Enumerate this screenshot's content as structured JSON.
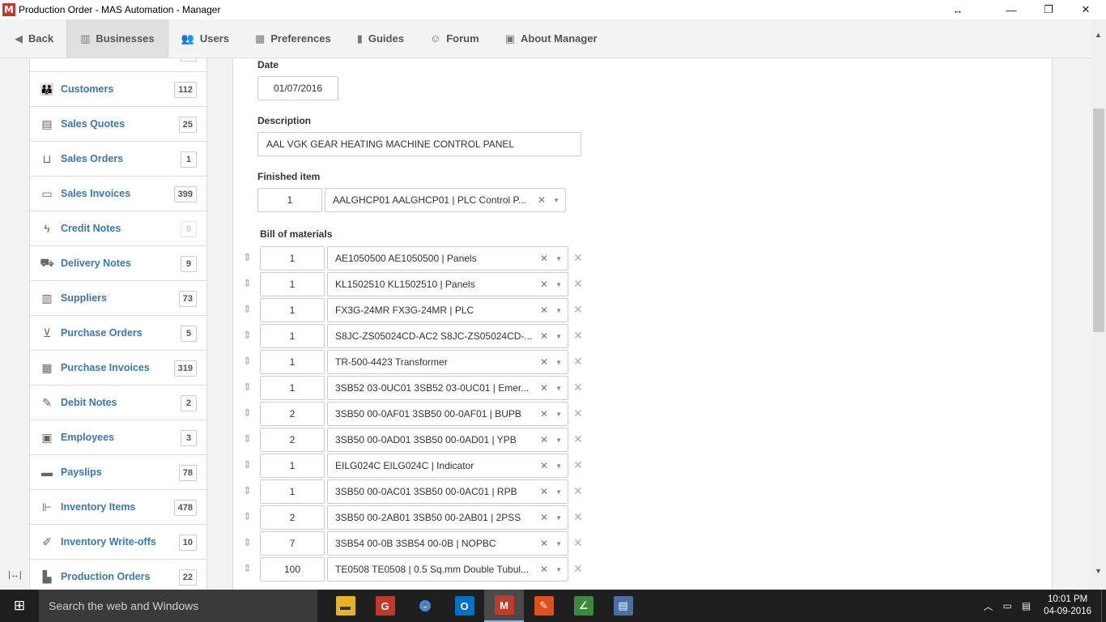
{
  "window": {
    "title": "Production Order - MAS Automation - Manager",
    "app_logo": "M",
    "controls": {
      "move": "↔",
      "minimize": "—",
      "maximize": "❐",
      "close": "✕"
    }
  },
  "nav": {
    "back": "Back",
    "businesses": "Businesses",
    "users": "Users",
    "preferences": "Preferences",
    "guides": "Guides",
    "forum": "Forum",
    "about": "About Manager"
  },
  "sidebar": {
    "items": [
      {
        "label": "Customers",
        "count": "112",
        "icon": "customers-icon"
      },
      {
        "label": "Sales Quotes",
        "count": "25",
        "icon": "sales-quotes-icon"
      },
      {
        "label": "Sales Orders",
        "count": "1",
        "icon": "sales-orders-icon"
      },
      {
        "label": "Sales Invoices",
        "count": "399",
        "icon": "sales-invoices-icon"
      },
      {
        "label": "Credit Notes",
        "count": "0",
        "icon": "credit-notes-icon"
      },
      {
        "label": "Delivery Notes",
        "count": "9",
        "icon": "delivery-notes-icon"
      },
      {
        "label": "Suppliers",
        "count": "73",
        "icon": "suppliers-icon"
      },
      {
        "label": "Purchase Orders",
        "count": "5",
        "icon": "purchase-orders-icon"
      },
      {
        "label": "Purchase Invoices",
        "count": "319",
        "icon": "purchase-invoices-icon"
      },
      {
        "label": "Debit Notes",
        "count": "2",
        "icon": "debit-notes-icon"
      },
      {
        "label": "Employees",
        "count": "3",
        "icon": "employees-icon"
      },
      {
        "label": "Payslips",
        "count": "78",
        "icon": "payslips-icon"
      },
      {
        "label": "Inventory Items",
        "count": "478",
        "icon": "inventory-items-icon"
      },
      {
        "label": "Inventory Write-offs",
        "count": "10",
        "icon": "inventory-writeoffs-icon"
      },
      {
        "label": "Production Orders",
        "count": "22",
        "icon": "production-orders-icon"
      }
    ]
  },
  "form": {
    "date_label": "Date",
    "date_value": "01/07/2016",
    "description_label": "Description",
    "description_value": "AAL VGK GEAR HEATING MACHINE CONTROL PANEL",
    "finished_item_label": "Finished item",
    "finished_qty": "1",
    "finished_item": "AALGHCP01 AALGHCP01 | PLC Control P...",
    "bom_label": "Bill of materials",
    "bom": [
      {
        "qty": "1",
        "item": "AE1050500 AE1050500 | Panels"
      },
      {
        "qty": "1",
        "item": "KL1502510 KL1502510 | Panels"
      },
      {
        "qty": "1",
        "item": "FX3G-24MR FX3G-24MR | PLC"
      },
      {
        "qty": "1",
        "item": "S8JC-ZS05024CD-AC2 S8JC-ZS05024CD-..."
      },
      {
        "qty": "1",
        "item": "TR-500-4423 Transformer"
      },
      {
        "qty": "1",
        "item": "3SB52 03-0UC01 3SB52 03-0UC01 | Emer..."
      },
      {
        "qty": "2",
        "item": "3SB50 00-0AF01 3SB50 00-0AF01 | BUPB"
      },
      {
        "qty": "2",
        "item": "3SB50 00-0AD01 3SB50 00-0AD01 | YPB"
      },
      {
        "qty": "1",
        "item": "EILG024C EILG024C | Indicator"
      },
      {
        "qty": "1",
        "item": "3SB50 00-0AC01 3SB50 00-0AC01 | RPB"
      },
      {
        "qty": "2",
        "item": "3SB50 00-2AB01 3SB50 00-2AB01 | 2PSS"
      },
      {
        "qty": "7",
        "item": "3SB54 00-0B 3SB54 00-0B | NOPBC"
      },
      {
        "qty": "100",
        "item": "TE0508 TE0508 | 0.5 Sq.mm Double Tubul..."
      }
    ]
  },
  "taskbar": {
    "search_placeholder": "Search the web and Windows",
    "time": "10:01 PM",
    "date": "04-09-2016"
  }
}
